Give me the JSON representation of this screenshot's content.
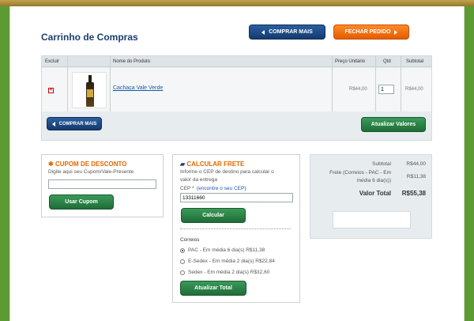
{
  "header": {
    "title": "Carrinho de Compras",
    "buy_more": "COMPRAR MAIS",
    "checkout": "FECHAR PEDIDO"
  },
  "cart": {
    "columns": [
      "Excluir",
      "Nome do Produto",
      "Preço Unitário",
      "Qtd",
      "Subtotal"
    ],
    "items": [
      {
        "name": "Cachaça Vale Verde",
        "unit_price": "R$44,00",
        "qty": "1",
        "subtotal": "R$44,00"
      }
    ],
    "buy_more": "COMPRAR MAIS",
    "update": "Atualizar Valores"
  },
  "coupon": {
    "title": "CUPOM DE DESCONTO",
    "hint": "Digite aqui seu Cupom/Vale-Presente",
    "value": "",
    "button": "Usar Cupom"
  },
  "shipping": {
    "title": "CALCULAR FRETE",
    "hint_line1": "Informe o CEP de destino para calcular o",
    "hint_line2": "valor da entrega",
    "cep_label": "CEP *",
    "find_cep": "(encontre o seu CEP)",
    "cep_value": "13311660",
    "calc_button": "Calcular",
    "carrier_label": "Correios",
    "options": [
      {
        "label": "PAC - Em média 6 dia(s) R$11,38",
        "selected": true
      },
      {
        "label": "E-Sedex - Em média 2 dia(s) R$22,84",
        "selected": false
      },
      {
        "label": "Sedex - Em média 2 dia(s) R$32,60",
        "selected": false
      }
    ],
    "update_total": "Atualizar Total"
  },
  "totals": {
    "subtotal_label": "Subtotal",
    "subtotal_value": "R$44,00",
    "freight_line1": "Frete (Correios - PAC - Em",
    "freight_line2": "média 6 dia(s))",
    "freight_value": "R$11,38",
    "total_label": "Valor Total",
    "total_value": "R$55,38"
  },
  "colors": {
    "navy": "#1b3d6e",
    "orange": "#e25c00",
    "green": "#2a8047",
    "link": "#1c58a8"
  }
}
